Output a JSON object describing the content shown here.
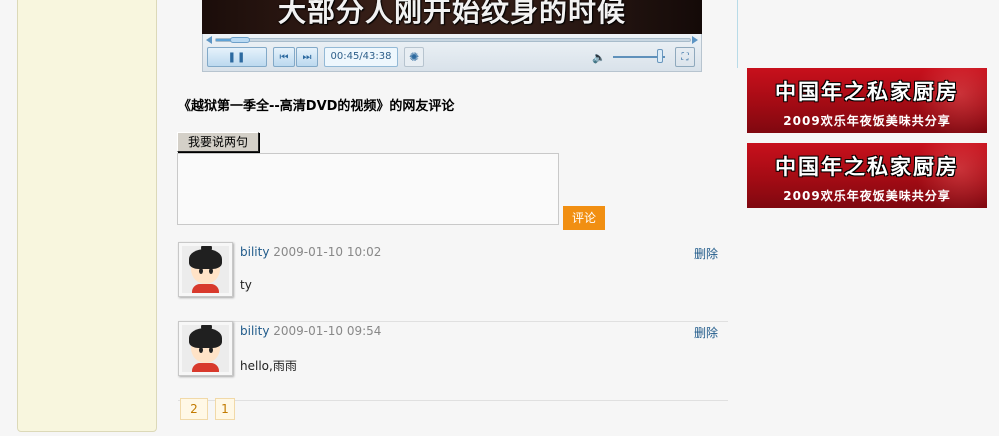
{
  "video": {
    "subtitle": "大部分人刚开始纹身的时候",
    "time": "00:45/43:38",
    "progress": 0.017,
    "volume": 0.85
  },
  "comments_section": {
    "title": "《越狱第一季全--高清DVD的视频》的网友评论",
    "say_button": "我要说两句",
    "submit": "评论",
    "delete_label": "删除"
  },
  "comments": [
    {
      "user": "bility",
      "date": "2009-01-10 10:02",
      "text": "ty"
    },
    {
      "user": "bility",
      "date": "2009-01-10 09:54",
      "text": "hello,雨雨"
    }
  ],
  "pagination": [
    "2",
    "1"
  ],
  "banners": [
    {
      "title": "中国年之私家厨房",
      "subtitle": "2009欢乐年夜饭美味共分享"
    },
    {
      "title": "中国年之私家厨房",
      "subtitle": "2009欢乐年夜饭美味共分享"
    }
  ],
  "colors": {
    "accent_orange": "#f18f12",
    "link_blue": "#1f5a8a",
    "banner_red": "#c8101c",
    "panel_cream": "#f8f6de"
  }
}
